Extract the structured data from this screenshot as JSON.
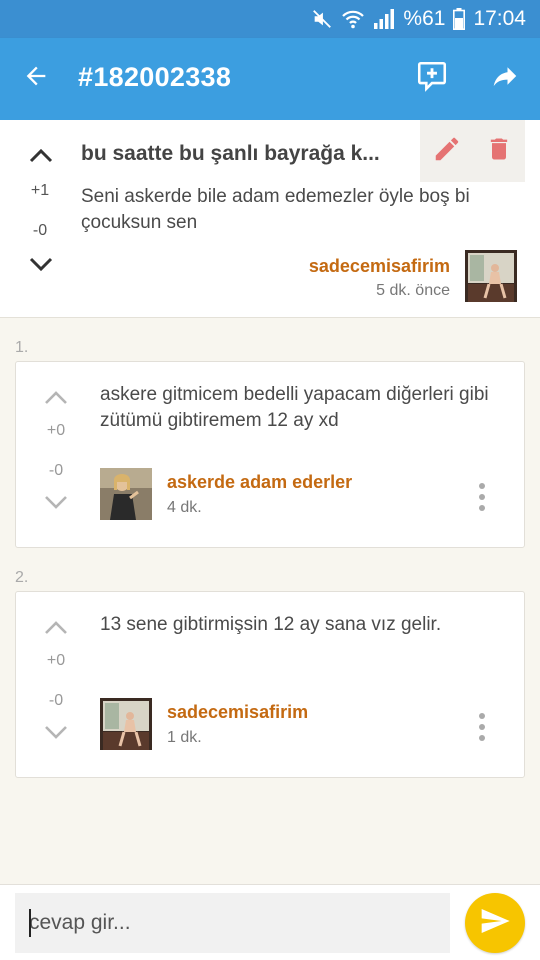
{
  "status_bar": {
    "battery": "%61",
    "time": "17:04",
    "icons": [
      "mute-icon",
      "wifi-icon",
      "signal-icon",
      "battery-icon"
    ]
  },
  "app_bar": {
    "title": "#182002338",
    "icons": [
      "back-arrow-icon",
      "add-comment-icon",
      "share-icon"
    ]
  },
  "topic": {
    "title": "bu saatte bu şanlı bayrağa k...",
    "body": "Seni askerde bile adam edemezler öyle boş bi çocuksun sen",
    "upvotes": "+1",
    "downvotes": "-0",
    "author": "sadecemisafirim",
    "time": "5 dk. önce",
    "actions": [
      "edit-icon",
      "delete-icon"
    ]
  },
  "comments": [
    {
      "number": "1.",
      "text": "askere gitmicem bedelli yapacam diğerleri gibi zütümü gibtiremem 12 ay xd",
      "upvotes": "+0",
      "downvotes": "-0",
      "author": "askerde adam ederler",
      "time": "4 dk."
    },
    {
      "number": "2.",
      "text": "13 sene gibtirmişsin 12 ay sana vız gelir.",
      "upvotes": "+0",
      "downvotes": "-0",
      "author": "sadecemisafirim",
      "time": "1 dk."
    }
  ],
  "reply": {
    "placeholder": "cevap gir..."
  },
  "colors": {
    "status_bar": "#3b8fd1",
    "app_bar": "#3c9ee0",
    "author": "#c46a12",
    "action_red": "#e57373",
    "send": "#f7c500",
    "background": "#f8f6ef"
  }
}
